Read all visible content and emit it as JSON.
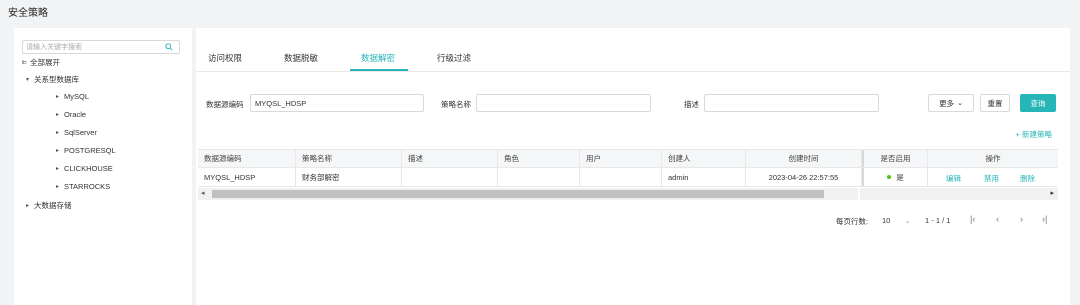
{
  "page_title": "安全策略",
  "sidebar": {
    "search_placeholder": "请输入关键字搜索",
    "expand_all": "全部展开",
    "group_relational": "关系型数据库",
    "items": [
      "MySQL",
      "Oracle",
      "SqlServer",
      "POSTGRESQL",
      "CLICKHOUSE",
      "STARROCKS"
    ],
    "group_bigdata": "大数据存储"
  },
  "tabs": [
    "访问权限",
    "数据脱敏",
    "数据解密",
    "行级过滤"
  ],
  "active_tab": "数据解密",
  "filters": {
    "datasource_label": "数据源编码",
    "datasource_value": "MYQSL_HDSP",
    "policy_label": "策略名称",
    "policy_value": "",
    "desc_label": "描述",
    "desc_value": "",
    "more_label": "更多",
    "reset_label": "重置",
    "query_label": "查询"
  },
  "add_policy": "+ 新建策略",
  "table": {
    "headers": [
      "数据源编码",
      "策略名称",
      "描述",
      "角色",
      "用户",
      "创建人",
      "创建时间",
      "是否启用",
      "操作"
    ],
    "rows": [
      {
        "datasource": "MYQSL_HDSP",
        "policy": "财务部解密",
        "desc": "",
        "role": "",
        "user": "",
        "creator": "admin",
        "created": "2023-04-26 22:57:55",
        "enabled": "是",
        "ops": [
          "编辑",
          "禁用",
          "删除"
        ]
      }
    ]
  },
  "pagination": {
    "per_page_label": "每页行数:",
    "per_page_value": "10",
    "range": "1 - 1 / 1"
  },
  "colors": {
    "accent": "#26b6b8",
    "enabled_dot": "#52c41a"
  }
}
